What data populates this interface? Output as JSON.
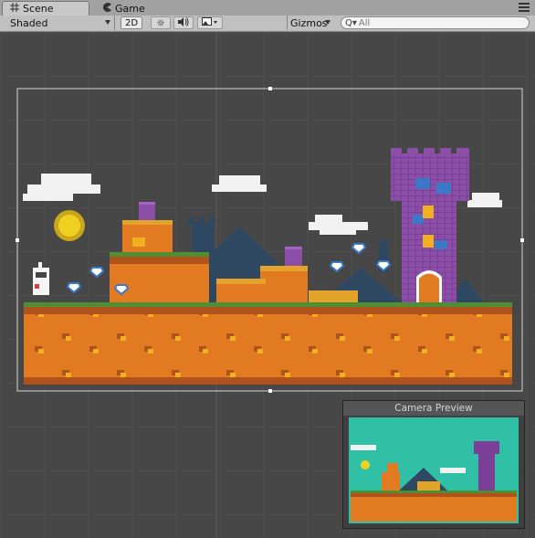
{
  "tabs": [
    {
      "label": "Scene",
      "icon": "grid-icon",
      "active": true
    },
    {
      "label": "Game",
      "icon": "pacman-icon",
      "active": false
    }
  ],
  "toolbar": {
    "draw_mode": "Shaded",
    "mode_2d": "2D",
    "gizmos": "Gizmos",
    "search_placeholder": "All",
    "search_prefix": "Q▾"
  },
  "preview": {
    "title": "Camera Preview"
  },
  "colors": {
    "ground_orange": "#e27a22",
    "ground_dark": "#b0521c",
    "grass": "#4f8e32",
    "tower_purple": "#7b3f97",
    "tower_blue": "#3b78c8",
    "mountain": "#2f4862",
    "sun": "#f0d020",
    "preview_sky": "#2fc0a6",
    "scene_bg": "#474747"
  }
}
